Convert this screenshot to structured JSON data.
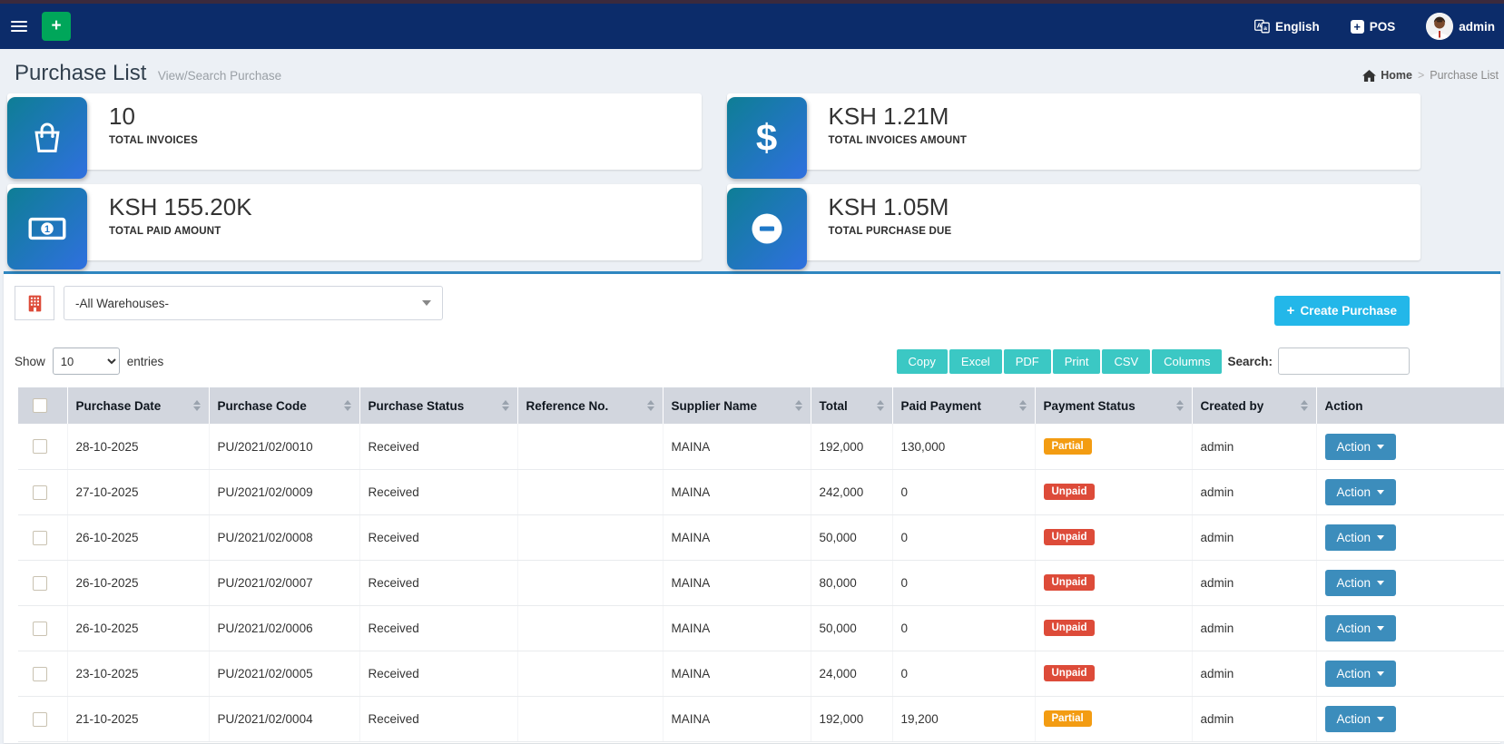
{
  "colors": {
    "navbar": "#0c2c6a",
    "panel_accent": "#2e86c0",
    "add_button_green": "#00a65a",
    "create_button_cyan": "#23b7e9",
    "export_button_teal": "#3bc8c4",
    "action_button_blue": "#3c8dbc",
    "badge_partial_orange": "#f39c12",
    "badge_unpaid_red": "#dd4b39",
    "icon_gradient_start": "#0e7e95",
    "icon_gradient_end": "#2f70df"
  },
  "navbar": {
    "add_label": "+",
    "language_label": "English",
    "pos_label": "POS",
    "user_label": "admin"
  },
  "page_header": {
    "title": "Purchase List",
    "subtitle": "View/Search Purchase",
    "breadcrumb_home": "Home",
    "breadcrumb_sep": ">",
    "breadcrumb_current": "Purchase List"
  },
  "stats": [
    {
      "icon": "shopping-bag-icon",
      "value": "10",
      "label": "TOTAL INVOICES"
    },
    {
      "icon": "dollar-icon",
      "value": "KSH 1.21M",
      "label": "TOTAL INVOICES AMOUNT"
    },
    {
      "icon": "banknote-icon",
      "value": "KSH 155.20K",
      "label": "TOTAL PAID AMOUNT"
    },
    {
      "icon": "minus-circle-icon",
      "value": "KSH 1.05M",
      "label": "TOTAL PURCHASE DUE"
    }
  ],
  "filters": {
    "warehouse_selected": "-All Warehouses-",
    "create_button_label": "Create Purchase",
    "create_button_plus": "+"
  },
  "table_controls": {
    "show_label": "Show",
    "page_length": "10",
    "entries_label": "entries",
    "export_buttons": [
      "Copy",
      "Excel",
      "PDF",
      "Print",
      "CSV",
      "Columns"
    ],
    "search_label": "Search:",
    "search_value": ""
  },
  "table": {
    "columns": [
      "Purchase Date",
      "Purchase Code",
      "Purchase Status",
      "Reference No.",
      "Supplier Name",
      "Total",
      "Paid Payment",
      "Payment Status",
      "Created by",
      "Action"
    ],
    "rows": [
      {
        "purchase_date": "28-10-2025",
        "purchase_code": "PU/2021/02/0010",
        "purchase_status": "Received",
        "reference_no": "",
        "supplier_name": "MAINA",
        "total": "192,000",
        "paid_payment": "130,000",
        "payment_status": "Partial",
        "created_by": "admin",
        "action_label": "Action"
      },
      {
        "purchase_date": "27-10-2025",
        "purchase_code": "PU/2021/02/0009",
        "purchase_status": "Received",
        "reference_no": "",
        "supplier_name": "MAINA",
        "total": "242,000",
        "paid_payment": "0",
        "payment_status": "Unpaid",
        "created_by": "admin",
        "action_label": "Action"
      },
      {
        "purchase_date": "26-10-2025",
        "purchase_code": "PU/2021/02/0008",
        "purchase_status": "Received",
        "reference_no": "",
        "supplier_name": "MAINA",
        "total": "50,000",
        "paid_payment": "0",
        "payment_status": "Unpaid",
        "created_by": "admin",
        "action_label": "Action"
      },
      {
        "purchase_date": "26-10-2025",
        "purchase_code": "PU/2021/02/0007",
        "purchase_status": "Received",
        "reference_no": "",
        "supplier_name": "MAINA",
        "total": "80,000",
        "paid_payment": "0",
        "payment_status": "Unpaid",
        "created_by": "admin",
        "action_label": "Action"
      },
      {
        "purchase_date": "26-10-2025",
        "purchase_code": "PU/2021/02/0006",
        "purchase_status": "Received",
        "reference_no": "",
        "supplier_name": "MAINA",
        "total": "50,000",
        "paid_payment": "0",
        "payment_status": "Unpaid",
        "created_by": "admin",
        "action_label": "Action"
      },
      {
        "purchase_date": "23-10-2025",
        "purchase_code": "PU/2021/02/0005",
        "purchase_status": "Received",
        "reference_no": "",
        "supplier_name": "MAINA",
        "total": "24,000",
        "paid_payment": "0",
        "payment_status": "Unpaid",
        "created_by": "admin",
        "action_label": "Action"
      },
      {
        "purchase_date": "21-10-2025",
        "purchase_code": "PU/2021/02/0004",
        "purchase_status": "Received",
        "reference_no": "",
        "supplier_name": "MAINA",
        "total": "192,000",
        "paid_payment": "19,200",
        "payment_status": "Partial",
        "created_by": "admin",
        "action_label": "Action"
      }
    ]
  }
}
